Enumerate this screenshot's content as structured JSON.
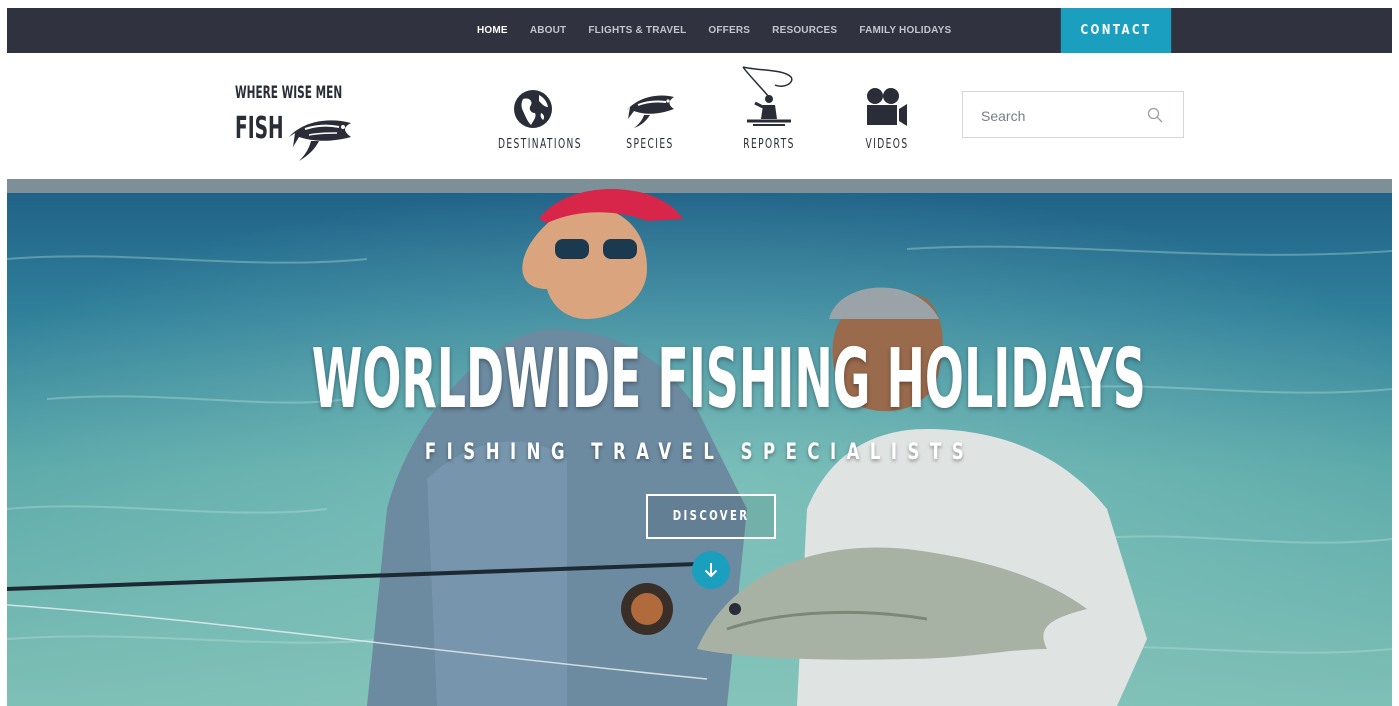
{
  "topnav": {
    "items": [
      "HOME",
      "ABOUT",
      "FLIGHTS & TRAVEL",
      "OFFERS",
      "RESOURCES",
      "FAMILY HOLIDAYS"
    ],
    "contact_label": "CONTACT"
  },
  "logo": {
    "line1": "WHERE WISE MEN",
    "line2": "FISH"
  },
  "icon_nav": [
    {
      "label": "DESTINATIONS",
      "icon": "globe-icon"
    },
    {
      "label": "SPECIES",
      "icon": "fish-icon"
    },
    {
      "label": "REPORTS",
      "icon": "angler-icon"
    },
    {
      "label": "VIDEOS",
      "icon": "video-camera-icon"
    }
  ],
  "search": {
    "placeholder": "Search",
    "value": ""
  },
  "hero": {
    "title": "WORLDWIDE FISHING HOLIDAYS",
    "subtitle": "FISHING TRAVEL SPECIALISTS",
    "cta_label": "DISCOVER"
  },
  "colors": {
    "topbar": "#30323f",
    "accent": "#1a9fbe",
    "ink": "#2a2c38"
  }
}
